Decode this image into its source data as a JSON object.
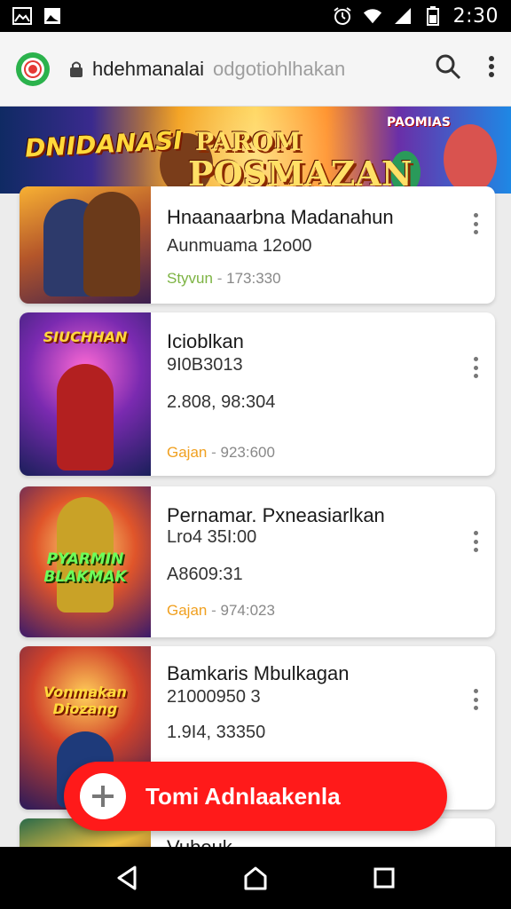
{
  "status_bar": {
    "time": "2:30",
    "icons": [
      "gallery-icon",
      "image-icon",
      "alarm-icon",
      "wifi-icon",
      "signal-icon",
      "battery-icon"
    ]
  },
  "browser": {
    "url_host": "hdehmanalai",
    "url_path": "odgotiohlhakan",
    "icons": [
      "site-logo",
      "lock-icon",
      "search-icon",
      "overflow-menu-icon"
    ]
  },
  "banner": {
    "left_text": "DNIDANASI",
    "center_text_1": "PAROM",
    "center_text_2": "POSMAZAN",
    "right_text": "PAOMIAS"
  },
  "items": [
    {
      "title": "Hnaanaarbna Madanahun",
      "line1": "Aunmuama 12o00",
      "line2": "",
      "meta_tag": "Styvun",
      "meta_value": "173:330",
      "meta_color": "#7cb342",
      "thumb_text": ""
    },
    {
      "title": "Icioblkan",
      "line1": "9I0B3013",
      "line2": "2.808, 98:304",
      "meta_tag": "Gajan",
      "meta_value": "923:600",
      "meta_color": "#f0a020",
      "thumb_text": "SIUCHHAN"
    },
    {
      "title": "Pernamar. Pxneasiarlkan",
      "line1": "Lro4 35I:00",
      "line2": "A8609:31",
      "meta_tag": "Gajan",
      "meta_value": "974:023",
      "meta_color": "#f0a020",
      "thumb_text": "PYARMIN BLAKMAK"
    },
    {
      "title": "Bamkaris Mbulkagan",
      "line1": "21000950 3",
      "line2": "1.9I4, 33350",
      "meta_tag": "",
      "meta_value": "",
      "meta_color": "#f0a020",
      "thumb_text": "Vonmakan Diozang"
    },
    {
      "title": "Vubouk",
      "line1": "",
      "line2": "",
      "meta_tag": "",
      "meta_value": "",
      "meta_color": "#f0a020",
      "thumb_text": ""
    }
  ],
  "fab": {
    "label": "Tomi Adnlaakenla",
    "icon": "plus-icon"
  },
  "nav_bar": {
    "icons": [
      "back-icon",
      "home-icon",
      "recents-icon"
    ]
  },
  "colors": {
    "fab": "#ff1a1a",
    "site_logo": "#2bb24c",
    "accent_red": "#e53935"
  }
}
